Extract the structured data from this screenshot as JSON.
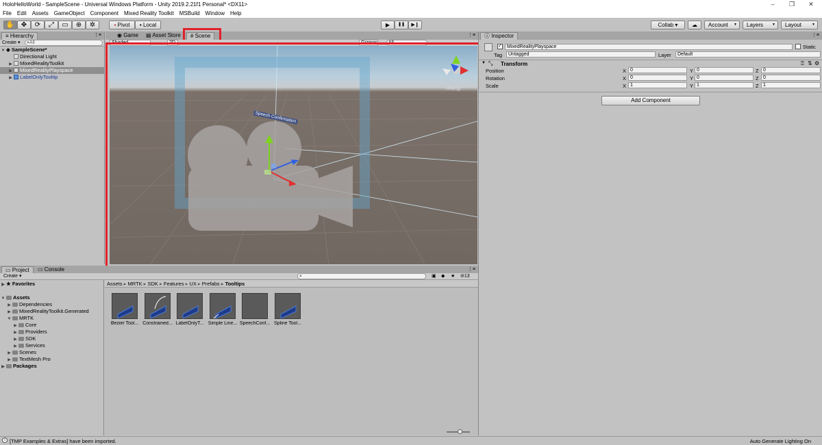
{
  "window": {
    "title": "HoloHelloWorld - SampleScene - Universal Windows Platform - Unity 2019.2.21f1 Personal* <DX11>",
    "controls": [
      "–",
      "❐",
      "✕"
    ]
  },
  "menu": [
    "File",
    "Edit",
    "Assets",
    "GameObject",
    "Component",
    "Mixed Reality Toolkit",
    "MSBuild",
    "Window",
    "Help"
  ],
  "toolbar": {
    "tools": [
      "✋",
      "✥",
      "⟳",
      "⤢",
      "▭",
      "⊕",
      "✲"
    ],
    "pivot_label": "Pivot",
    "local_label": "Local",
    "play_icons": [
      "▶",
      "❚❚",
      "▶❙"
    ],
    "collab_label": "Collab ▾",
    "account_label": "Account",
    "layers_label": "Layers",
    "layout_label": "Layout"
  },
  "hierarchy": {
    "tab": "Hierarchy",
    "create_label": "Create ▾",
    "search_placeholder": "All",
    "scene_name": "SampleScene*",
    "items": [
      {
        "label": "Directional Light",
        "selected": false,
        "prefab": false
      },
      {
        "label": "MixedRealityToolkit",
        "selected": false,
        "prefab": false
      },
      {
        "label": "MixedRealityPlayspace",
        "selected": true,
        "prefab": false
      },
      {
        "label": "LabelOnlyTooltip",
        "selected": false,
        "prefab": true
      }
    ]
  },
  "center_tabs": {
    "game": "Game",
    "asset_store": "Asset Store",
    "scene": "Scene"
  },
  "scene": {
    "shading": "Shaded",
    "mode": "2D",
    "gizmos": "Gizmos",
    "search_placeholder": "All",
    "persp_label": "<Persp",
    "tooltip_text": "Speech Confirmation"
  },
  "inspector": {
    "tab": "Inspector",
    "object_name": "MixedRealityPlayspace",
    "static_label": "Static",
    "tag_label": "Tag",
    "tag_value": "Untagged",
    "layer_label": "Layer",
    "layer_value": "Default",
    "component_name": "Transform",
    "rows": [
      {
        "label": "Position",
        "x": "0",
        "y": "0",
        "z": "0"
      },
      {
        "label": "Rotation",
        "x": "0",
        "y": "0",
        "z": "0"
      },
      {
        "label": "Scale",
        "x": "1",
        "y": "1",
        "z": "1"
      }
    ],
    "axis_labels": [
      "X",
      "Y",
      "Z"
    ],
    "add_component_label": "Add Component"
  },
  "project": {
    "tab_project": "Project",
    "tab_console": "Console",
    "create_label": "Create ▾",
    "favorites": "Favorites",
    "tree": [
      {
        "label": "Assets",
        "depth": 0,
        "bold": true,
        "open": true
      },
      {
        "label": "Dependencies",
        "depth": 1,
        "bold": false,
        "open": false
      },
      {
        "label": "MixedRealityToolkit.Generated",
        "depth": 1,
        "bold": false,
        "open": false
      },
      {
        "label": "MRTK",
        "depth": 1,
        "bold": false,
        "open": true
      },
      {
        "label": "Core",
        "depth": 2,
        "bold": false,
        "open": false
      },
      {
        "label": "Providers",
        "depth": 2,
        "bold": false,
        "open": false
      },
      {
        "label": "SDK",
        "depth": 2,
        "bold": false,
        "open": false
      },
      {
        "label": "Services",
        "depth": 2,
        "bold": false,
        "open": false
      },
      {
        "label": "Scenes",
        "depth": 1,
        "bold": false,
        "open": false
      },
      {
        "label": "TextMesh Pro",
        "depth": 1,
        "bold": false,
        "open": false
      },
      {
        "label": "Packages",
        "depth": 0,
        "bold": true,
        "open": false
      }
    ],
    "breadcrumb": [
      "Assets",
      "MRTK",
      "SDK",
      "Features",
      "UX",
      "Prefabs",
      "Tooltips"
    ],
    "file_count": "13",
    "assets": [
      "Bezier Tool...",
      "Constrained...",
      "LabelOnlyT...",
      "Simple Line...",
      "SpeechConf...",
      "Spline Tool..."
    ]
  },
  "status": {
    "message": "[TMP Examples & Extras] have been imported.",
    "right": "Auto Generate Lighting On"
  },
  "colors": {
    "highlight_red": "#e0202a",
    "selection": "#8f8f8f",
    "prefab_blue": "#1a3a9a"
  }
}
